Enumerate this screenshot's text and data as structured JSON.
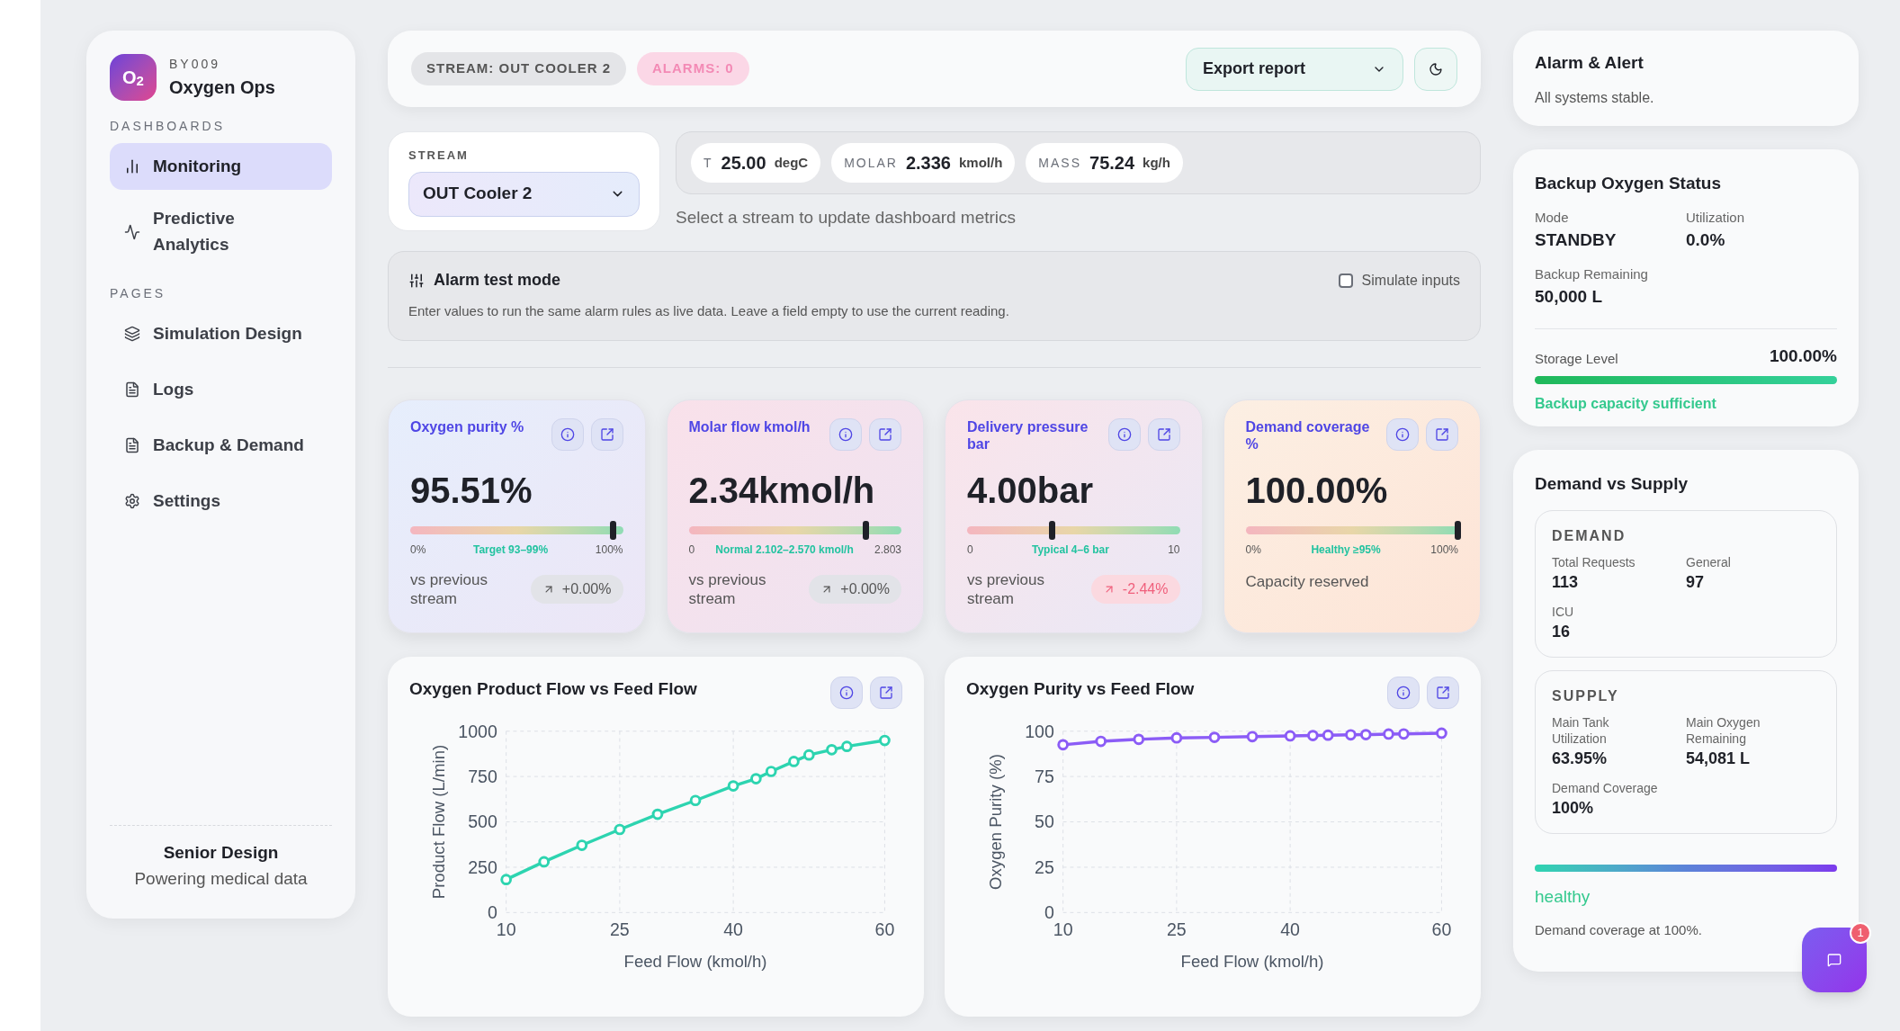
{
  "sidebar": {
    "brand": {
      "logo": "O$_{2}$",
      "code": "BY009",
      "name": "Oxygen Ops"
    },
    "sections": [
      {
        "title": "DASHBOARDS",
        "items": [
          {
            "label": "Monitoring",
            "selected": true
          },
          {
            "label": "Predictive Analytics",
            "selected": false
          }
        ]
      },
      {
        "title": "PAGES",
        "items": [
          {
            "label": "Simulation Design",
            "selected": false
          },
          {
            "label": "Logs",
            "selected": false
          },
          {
            "label": "Backup & Demand",
            "selected": false
          },
          {
            "label": "Settings",
            "selected": false
          }
        ]
      }
    ],
    "footer": {
      "title": "Senior Design",
      "subtitle": "Powering medical data"
    }
  },
  "header": {
    "stream_chip": "STREAM: OUT COOLER 2",
    "alarms_chip": "ALARMS: 0",
    "export_button": "Export report"
  },
  "stream_select": {
    "label": "STREAM",
    "value": "OUT Cooler 2"
  },
  "readings": [
    {
      "label": "T",
      "value": "25.00",
      "unit": "degC"
    },
    {
      "label": "MOLAR",
      "value": "2.336",
      "unit": "kmol/h"
    },
    {
      "label": "MASS",
      "value": "75.24",
      "unit": "kg/h"
    }
  ],
  "readings_hint": "Select a stream to update dashboard metrics",
  "alarm_test": {
    "title": "Alarm test mode",
    "description": "Enter values to run the same alarm rules as live data. Leave a field empty to use the current reading.",
    "simulate": {
      "label": "Simulate inputs",
      "checked": false
    }
  },
  "metrics": [
    {
      "title": "Oxygen purity %",
      "value": "95.51%",
      "level": 0.955,
      "scale": [
        "0%",
        "Target 93–99%",
        "100%"
      ],
      "footer": {
        "kind": "delta",
        "label": "vs previous stream",
        "delta": "+0.00%",
        "negative": false
      }
    },
    {
      "title": "Molar flow kmol/h",
      "value": "2.34kmol/h",
      "level": 0.835,
      "scale": [
        "0",
        "Normal 2.102–2.570 kmol/h",
        "2.803"
      ],
      "footer": {
        "kind": "delta",
        "label": "vs previous stream",
        "delta": "+0.00%",
        "negative": false
      }
    },
    {
      "title": "Delivery pressure bar",
      "value": "4.00bar",
      "level": 0.4,
      "scale": [
        "0",
        "Typical 4–6 bar",
        "10"
      ],
      "footer": {
        "kind": "delta",
        "label": "vs previous stream",
        "delta": "-2.44%",
        "negative": true
      }
    },
    {
      "title": "Demand coverage %",
      "value": "100.00%",
      "level": 1.0,
      "scale": [
        "0%",
        "Healthy ≥95%",
        "100%"
      ],
      "footer": {
        "kind": "note",
        "label": "Capacity reserved"
      }
    }
  ],
  "charts": [
    {
      "chart_data": {
        "type": "line",
        "title": "Oxygen Product Flow vs Feed Flow",
        "xlabel": "Feed Flow (kmol/h)",
        "ylabel": "Product Flow (L/min)",
        "x": [
          10,
          15,
          20,
          25,
          30,
          35,
          40,
          43,
          45,
          48,
          50,
          53,
          55,
          60
        ],
        "grid": true,
        "series": [
          {
            "color": "#2dd4b0",
            "marker": "circle",
            "values": [
              182,
              280,
              371,
              458,
              542,
              618,
              698,
              738,
              778,
              833,
              869,
              898,
              916,
              949
            ]
          }
        ],
        "xlim": [
          10,
          60
        ],
        "ylim": [
          0,
          1000
        ],
        "xticks": [
          10,
          25,
          40,
          60
        ],
        "yticks": [
          0,
          250,
          500,
          750,
          1000
        ]
      }
    },
    {
      "chart_data": {
        "type": "line",
        "title": "Oxygen Purity vs Feed Flow",
        "xlabel": "Feed Flow (kmol/h)",
        "ylabel": "Oxygen Purity (%)",
        "x": [
          10,
          15,
          20,
          25,
          30,
          35,
          40,
          43,
          45,
          48,
          50,
          53,
          55,
          60
        ],
        "grid": true,
        "series": [
          {
            "color": "#8b5cf6",
            "marker": "circle",
            "values": [
              92.5,
              94.4,
              95.5,
              96.3,
              96.6,
              97.0,
              97.4,
              97.6,
              97.8,
              98.0,
              98.1,
              98.4,
              98.5,
              98.9
            ]
          }
        ],
        "xlim": [
          10,
          60
        ],
        "ylim": [
          0,
          100
        ],
        "xticks": [
          10,
          25,
          40,
          60
        ],
        "yticks": [
          0,
          25,
          50,
          75,
          100
        ]
      }
    }
  ],
  "alarm_alert": {
    "title": "Alarm & Alert",
    "message": "All systems stable."
  },
  "backup": {
    "title": "Backup Oxygen Status",
    "fields": [
      {
        "label": "Mode",
        "value": "STANDBY"
      },
      {
        "label": "Utilization",
        "value": "0.0%"
      },
      {
        "label": "Backup Remaining",
        "value": "50,000 L"
      }
    ],
    "storage": {
      "label": "Storage Level",
      "value": "100.00%",
      "level": 1.0
    },
    "status": "Backup capacity sufficient"
  },
  "demand_supply": {
    "title": "Demand vs Supply",
    "groups": [
      {
        "title": "DEMAND",
        "fields": [
          {
            "label": "Total Requests",
            "value": "113"
          },
          {
            "label": "General",
            "value": "97"
          },
          {
            "label": "ICU",
            "value": "16"
          }
        ]
      },
      {
        "title": "SUPPLY",
        "fields": [
          {
            "label": "Main Tank Utilization",
            "value": "63.95%"
          },
          {
            "label": "Main Oxygen Remaining",
            "value": "54,081 L"
          },
          {
            "label": "Demand Coverage",
            "value": "100%"
          }
        ]
      }
    ],
    "level": 1.0,
    "status": "healthy",
    "note": "Demand coverage at 100%."
  },
  "chat": {
    "badge": "1"
  }
}
